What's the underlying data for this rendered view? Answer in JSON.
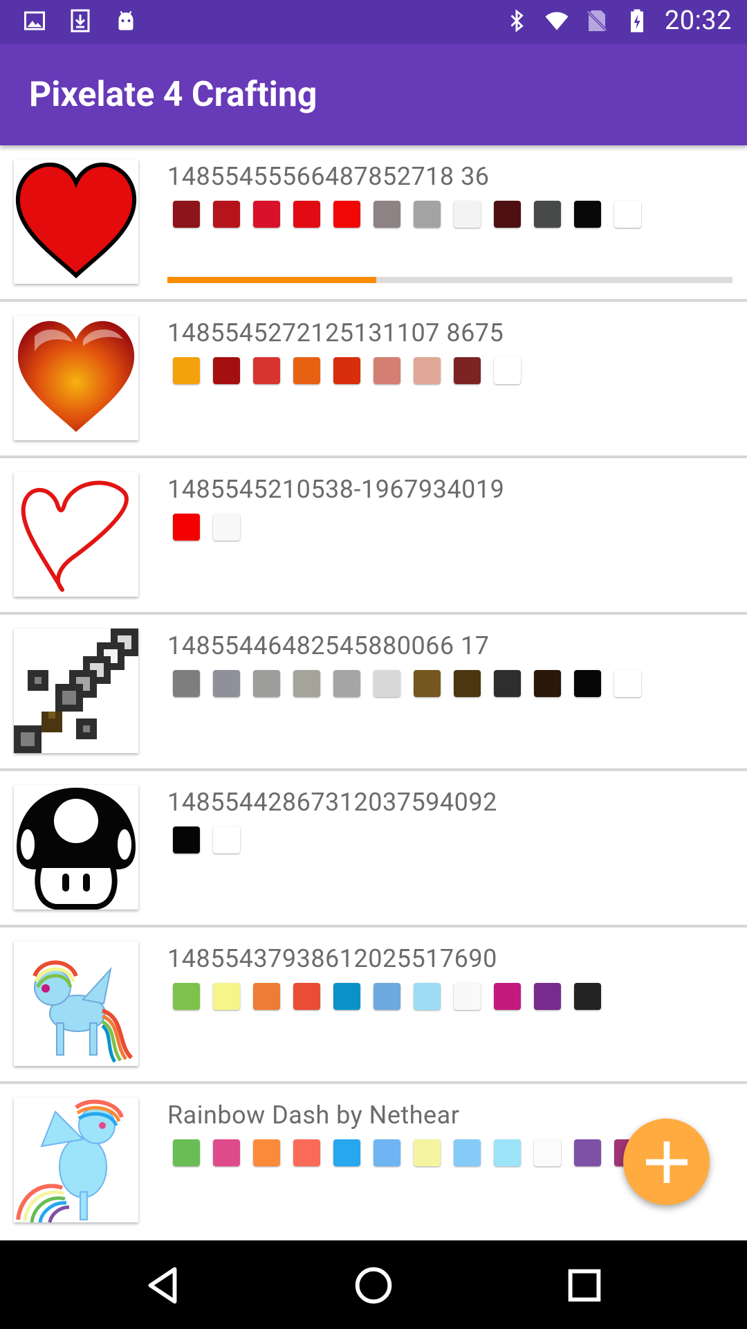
{
  "statusbar": {
    "time": "20:32",
    "left_icons": [
      "image-icon",
      "download-icon",
      "android-icon"
    ],
    "right_icons": [
      "bluetooth-icon",
      "wifi-icon",
      "no-sim-icon",
      "battery-charging-icon"
    ]
  },
  "appbar": {
    "title": "Pixelate 4 Crafting"
  },
  "items": [
    {
      "name": "14855455566487852718 36",
      "thumb": "red-heart-outline",
      "colors": [
        "#8c1519",
        "#b5141a",
        "#d9112a",
        "#e30b13",
        "#f20707",
        "#8e8284",
        "#a3a3a3",
        "#f3f3f3",
        "#4e1010",
        "#474a49",
        "#080808",
        "#ffffff"
      ],
      "progress": 0.37
    },
    {
      "name": "1485545272125131107 8675",
      "thumb": "glossy-heart",
      "colors": [
        "#f4a20b",
        "#a3100f",
        "#d73430",
        "#e86113",
        "#d92e0c",
        "#d47f73",
        "#e0a897",
        "#7c2424",
        "#ffffff"
      ]
    },
    {
      "name": "1485545210538-1967934019",
      "thumb": "sketch-heart",
      "colors": [
        "#f50000",
        "#f8f8f8"
      ]
    },
    {
      "name": "14855446482545880066 17",
      "thumb": "pixel-sword",
      "colors": [
        "#7e7e7e",
        "#8f909a",
        "#9d9d9c",
        "#a4a49b",
        "#a5a5a5",
        "#d8d8d8",
        "#74571e",
        "#4b3611",
        "#2e2e2e",
        "#2a1707",
        "#060606",
        "#ffffff"
      ]
    },
    {
      "name": "14855442867312037594092",
      "thumb": "mushroom",
      "colors": [
        "#050505",
        "#ffffff"
      ]
    },
    {
      "name": "14855437938612025517690",
      "thumb": "pony-standing",
      "colors": [
        "#7dc24b",
        "#f5f58a",
        "#ef7c35",
        "#e94d33",
        "#0a92c8",
        "#6eaadd",
        "#9cdcf5",
        "#f9f9f9",
        "#c41a7d",
        "#772b8f",
        "#232323"
      ]
    },
    {
      "name": "Rainbow Dash by Nethear",
      "thumb": "pony-rearing",
      "colors": [
        "#68bd55",
        "#df4b8a",
        "#fb8b3b",
        "#fb6a58",
        "#26a7ee",
        "#6fb5f4",
        "#f5f4a0",
        "#85cbf8",
        "#9de3f9",
        "#fbfbfb",
        "#7e51a7",
        "#a03574"
      ]
    }
  ],
  "fab": {
    "icon": "plus-icon"
  },
  "navbar": {
    "buttons": [
      "back-icon",
      "home-icon",
      "recents-icon"
    ]
  }
}
